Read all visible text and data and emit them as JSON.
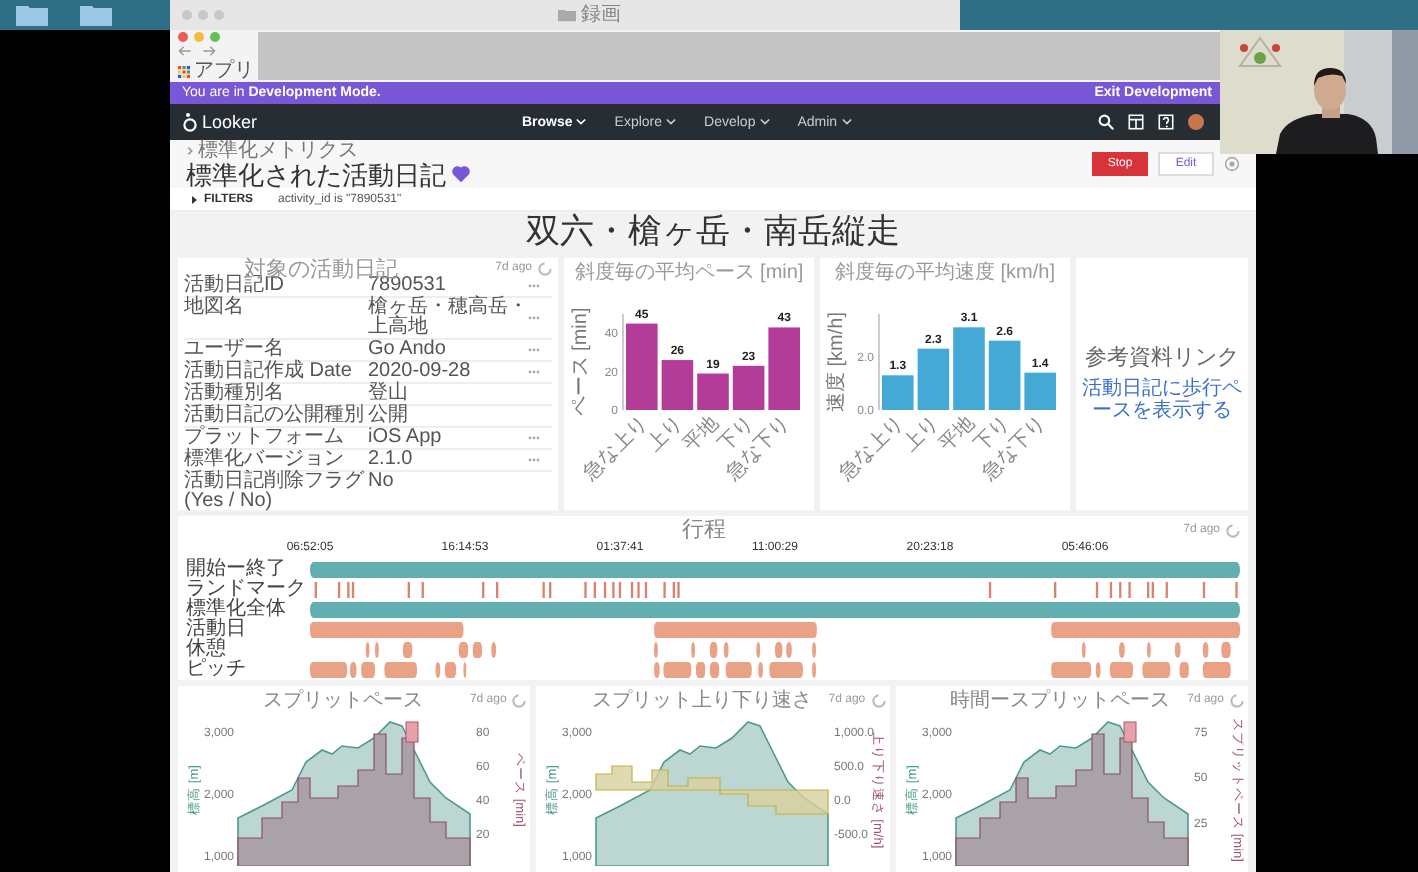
{
  "desktop": {
    "folder_title": "録画"
  },
  "browser": {
    "bookmark": "アプリ"
  },
  "dev_banner": {
    "message": "You are in **Development Mode.**",
    "exit_link": "Exit Development"
  },
  "nav": {
    "logo": "Looker",
    "items": [
      {
        "label": "Browse",
        "selected": true
      },
      {
        "label": "Explore",
        "selected": false
      },
      {
        "label": "Develop",
        "selected": false
      },
      {
        "label": "Admin",
        "selected": false
      }
    ]
  },
  "header": {
    "breadcrumb": "標準化メトリクス",
    "title": "標準化された活動日記",
    "favorite": true,
    "buttons": [
      {
        "label": "Stop",
        "kind": "primary"
      },
      {
        "label": "Edit",
        "kind": "secondary"
      }
    ]
  },
  "filters": {
    "label": "FILTERS",
    "expanded": false,
    "summary": "activity_id is \"7890531\""
  },
  "dashboard_title": "双六・槍ヶ岳・南岳縦走",
  "info_tile": {
    "title": "対象の活動日記",
    "age": "7d ago",
    "rows": [
      {
        "label": "活動日記ID",
        "value": "7890531",
        "actions": true
      },
      {
        "label": "地図名",
        "value": "槍ヶ岳・穂高岳・上高地",
        "actions": true
      },
      {
        "label": "ユーザー名",
        "value": "Go Ando",
        "actions": true
      },
      {
        "label": "活動日記作成 Date",
        "value": "2020-09-28",
        "actions": true
      },
      {
        "label": "活動種別名",
        "value": "登山",
        "actions": false
      },
      {
        "label": "活動日記の公開種別",
        "value": "公開",
        "actions": false
      },
      {
        "label": "プラットフォーム",
        "value": "iOS App",
        "actions": true
      },
      {
        "label": "標準化バージョン",
        "value": "2.1.0",
        "actions": true
      },
      {
        "label": "活動日記削除フラグ (Yes / No)",
        "value": "No",
        "actions": false
      }
    ]
  },
  "charts": [
    {
      "title": "斜度毎の平均ペース [min]",
      "chart_data": {
        "type": "bar",
        "ylabel": "ペース [min]",
        "categories": [
          "急な上り",
          "上り",
          "平地",
          "下り",
          "急な下り"
        ],
        "values": [
          45,
          26,
          19,
          23,
          43
        ],
        "ylim": [
          0,
          50
        ],
        "yticks": [
          0,
          20,
          40
        ],
        "data_labels": true
      }
    },
    {
      "title": "斜度毎の平均速度 [km/h]",
      "chart_data": {
        "type": "bar",
        "ylabel": "速度 [km/h]",
        "categories": [
          "急な上り",
          "上り",
          "平地",
          "下り",
          "急な下り"
        ],
        "values": [
          1.3,
          2.3,
          3.1,
          2.6,
          1.4
        ],
        "ylim": [
          0,
          3.6
        ],
        "yticks": [
          {
            "value": 0,
            "label": "0.0"
          },
          {
            "value": 2,
            "label": "2.0"
          }
        ],
        "data_labels": true
      }
    }
  ],
  "link_tile": {
    "title": "参考資料リンク",
    "link": "活動日記に歩行ペースを表示する"
  },
  "timeline": {
    "title": "行程",
    "age": "7d ago",
    "times": [
      "06:52:05",
      "16:14:53",
      "01:37:41",
      "11:00:29",
      "20:23:18",
      "05:46:06"
    ],
    "rows": [
      {
        "label": "開始ー終了",
        "kind": "span"
      },
      {
        "label": "ランドマーク",
        "kind": "marks"
      },
      {
        "label": "標準化全体",
        "kind": "span"
      },
      {
        "label": "活動日",
        "kind": "segments"
      },
      {
        "label": "休憩",
        "kind": "segments"
      },
      {
        "label": "ピッチ",
        "kind": "segments"
      }
    ]
  },
  "bottom_tiles": [
    {
      "title": "スプリットペース",
      "age": "7d ago",
      "kind": "pace",
      "left_axis": {
        "label": "標高 [m]",
        "ticks": [
          "3,000",
          "2,000",
          "1,000"
        ]
      },
      "right_axis": {
        "label": "ペース [min]",
        "ticks": [
          "80",
          "60",
          "40",
          "20"
        ]
      }
    },
    {
      "title": "スプリット上り下り速さ",
      "age": "7d ago",
      "kind": "speed",
      "left_axis": {
        "label": "標高 [m]",
        "ticks": [
          "3,000",
          "2,000",
          "1,000"
        ]
      },
      "right_axis": {
        "label": "上り下り速さ [m/h]",
        "ticks": [
          "1,000.0",
          "500.0",
          "0.0",
          "-500.0"
        ]
      }
    },
    {
      "title": "時間ースプリットペース",
      "age": "7d ago",
      "kind": "pace",
      "left_axis": {
        "label": "標高 [m]",
        "ticks": [
          "3,000",
          "2,000",
          "1,000"
        ]
      },
      "right_axis": {
        "label": "スプリットペース [min]",
        "ticks": [
          "75",
          "50",
          "25"
        ]
      }
    }
  ]
}
